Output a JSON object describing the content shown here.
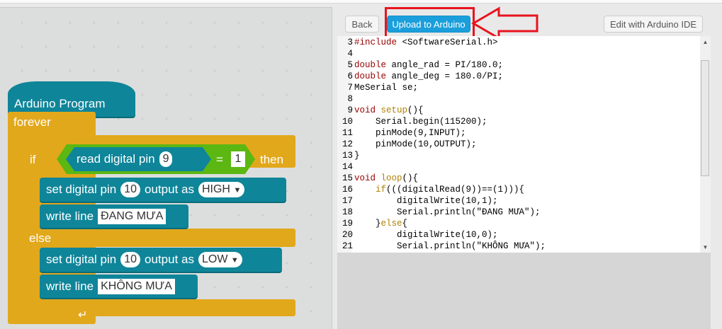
{
  "toolbar": {
    "back": "Back",
    "upload": "Upload to Arduino",
    "edit": "Edit with Arduino IDE"
  },
  "colors": {
    "block_teal": "#0f8599",
    "block_orange": "#e2a81c",
    "block_green": "#5cb712",
    "upload_blue": "#1a9fdc",
    "highlight_red": "#e8141e"
  },
  "blocks": {
    "hat": "Arduino  Program",
    "forever": "forever",
    "if": "if",
    "read": "read  digital  pin",
    "read_pin": "9",
    "eq": "=",
    "eq_val": "1",
    "then": "then",
    "set1": "set  digital  pin",
    "set1_pin": "10",
    "set1_mid": "output  as",
    "set1_val": "HIGH",
    "write1": "write  line",
    "write1_val": "ĐANG MƯA",
    "else": "else",
    "set2": "set  digital  pin",
    "set2_pin": "10",
    "set2_mid": "output  as",
    "set2_val": "LOW",
    "write2": "write  line",
    "write2_val": "KHÔNG MƯA"
  },
  "code": [
    {
      "n": "3",
      "t": [
        [
          "#include",
          "k"
        ],
        [
          " <SoftwareSerial.h>",
          ""
        ]
      ]
    },
    {
      "n": "4",
      "t": []
    },
    {
      "n": "5",
      "t": [
        [
          "double",
          "k"
        ],
        [
          " angle_rad = PI/180.0;",
          ""
        ]
      ]
    },
    {
      "n": "6",
      "t": [
        [
          "double",
          "k"
        ],
        [
          " angle_deg = 180.0/PI;",
          ""
        ]
      ]
    },
    {
      "n": "7",
      "t": [
        [
          "MeSerial se;",
          ""
        ]
      ]
    },
    {
      "n": "8",
      "t": []
    },
    {
      "n": "9",
      "t": [
        [
          "void",
          "k"
        ],
        [
          " ",
          ""
        ],
        [
          "setup",
          "f"
        ],
        [
          "(){",
          ""
        ]
      ]
    },
    {
      "n": "10",
      "t": [
        [
          "    Serial.begin(115200);",
          ""
        ]
      ]
    },
    {
      "n": "11",
      "t": [
        [
          "    pinMode(9,INPUT);",
          ""
        ]
      ]
    },
    {
      "n": "12",
      "t": [
        [
          "    pinMode(10,OUTPUT);",
          ""
        ]
      ]
    },
    {
      "n": "13",
      "t": [
        [
          "}",
          ""
        ]
      ]
    },
    {
      "n": "14",
      "t": []
    },
    {
      "n": "15",
      "t": [
        [
          "void",
          "k"
        ],
        [
          " ",
          ""
        ],
        [
          "loop",
          "f"
        ],
        [
          "(){",
          ""
        ]
      ]
    },
    {
      "n": "16",
      "t": [
        [
          "    ",
          ""
        ],
        [
          "if",
          "f"
        ],
        [
          "(((digitalRead(9))==(1))){",
          ""
        ]
      ]
    },
    {
      "n": "17",
      "t": [
        [
          "        digitalWrite(10,1);",
          ""
        ]
      ]
    },
    {
      "n": "18",
      "t": [
        [
          "        Serial.println(\"ĐANG MƯA\");",
          ""
        ]
      ]
    },
    {
      "n": "19",
      "t": [
        [
          "    }",
          ""
        ],
        [
          "else",
          "f"
        ],
        [
          "{",
          ""
        ]
      ]
    },
    {
      "n": "20",
      "t": [
        [
          "        digitalWrite(10,0);",
          ""
        ]
      ]
    },
    {
      "n": "21",
      "t": [
        [
          "        Serial.println(\"KHÔNG MƯA\");",
          ""
        ]
      ]
    }
  ]
}
